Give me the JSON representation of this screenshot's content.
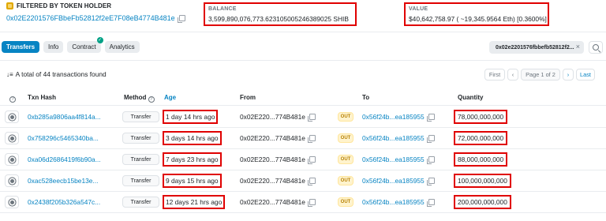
{
  "holder": {
    "title": "FILTERED BY TOKEN HOLDER",
    "address": "0x02E2201576FBbeFb52812f2eE7F08eB4774B481e"
  },
  "balance": {
    "label": "BALANCE",
    "value": "3,599,890,076,773.623105005246389025 SHIB"
  },
  "value": {
    "label": "VALUE",
    "value": "$40,642,758.97 ( ~19,345.9564 Eth) [0.3600%]"
  },
  "tabs": [
    {
      "label": "Transfers",
      "active": true
    },
    {
      "label": "Info",
      "active": false
    },
    {
      "label": "Contract",
      "active": false,
      "badge": "✓"
    },
    {
      "label": "Analytics",
      "active": false
    }
  ],
  "filter": {
    "chip_text": "0x02e2201576fbbefb52812f2...",
    "close": "×"
  },
  "summary": {
    "count_text": "A total of 44 transactions found"
  },
  "pager": {
    "first": "First",
    "prev": "‹",
    "info": "Page 1 of 2",
    "next": "›",
    "last": "Last"
  },
  "table": {
    "headers": {
      "help": "?",
      "hash": "Txn Hash",
      "method": "Method",
      "age": "Age",
      "from": "From",
      "to": "To",
      "quantity": "Quantity"
    },
    "rows": [
      {
        "hash": "0xb285a9806aa4f814a...",
        "method": "Transfer",
        "age": "1 day 14 hrs ago",
        "from": "0x02E220...774B481e",
        "dir": "OUT",
        "to": "0x56f24b...ea185955",
        "qty": "78,000,000,000"
      },
      {
        "hash": "0x758296c5465340ba...",
        "method": "Transfer",
        "age": "3 days 14 hrs ago",
        "from": "0x02E220...774B481e",
        "dir": "OUT",
        "to": "0x56f24b...ea185955",
        "qty": "72,000,000,000"
      },
      {
        "hash": "0xa06d2686419f6b90a...",
        "method": "Transfer",
        "age": "7 days 23 hrs ago",
        "from": "0x02E220...774B481e",
        "dir": "OUT",
        "to": "0x56f24b...ea185955",
        "qty": "88,000,000,000"
      },
      {
        "hash": "0xac528eecb15be13e...",
        "method": "Transfer",
        "age": "9 days 15 hrs ago",
        "from": "0x02E220...774B481e",
        "dir": "OUT",
        "to": "0x56f24b...ea185955",
        "qty": "100,000,000,000"
      },
      {
        "hash": "0x2438f205b326a547c...",
        "method": "Transfer",
        "age": "12 days 21 hrs ago",
        "from": "0x02E220...774B481e",
        "dir": "OUT",
        "to": "0x56f24b...ea185955",
        "qty": "200,000,000,000"
      }
    ]
  },
  "colors": {
    "accent": "#0784c3",
    "highlight_border": "#e00000",
    "out_badge": "#b78103"
  }
}
